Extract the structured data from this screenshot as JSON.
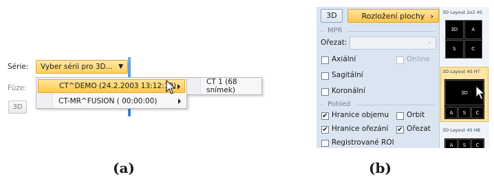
{
  "panel_a": {
    "series_label": "Série:",
    "series_value": "Vyber sérii pro 3D...",
    "fusion_label": "Fúze:",
    "btn_3d": "3D",
    "menu_items": [
      "CT^DEMO (24.2.2003 13:12:10)",
      "CT-MR^FUSION ( 00:00:00)"
    ],
    "submenu_item": "CT 1 (68 snímek)"
  },
  "panel_b": {
    "btn_3d": "3D",
    "layout_button": "Rozložení plochy",
    "mpr_section": "MPR",
    "crop_label": "Ořezat:",
    "axial": "Axiální",
    "online": "Online",
    "sagittal": "Sagitální",
    "coronal": "Koronální",
    "view_section": "Pohled",
    "volume_borders": "Hranice objemu",
    "orbit": "Orbit",
    "crop_borders": "Hranice ořezání",
    "crop": "Ořezat",
    "registered_roi": "Registrované ROI",
    "layouts": [
      {
        "title": "3D Layout 2x2 4S",
        "cells": [
          "3D",
          "A",
          "S",
          "C"
        ]
      },
      {
        "title": "3D Layout 4S HT",
        "cells": [
          "3D",
          "A",
          "S",
          "C"
        ]
      },
      {
        "title": "3D Layout 4S HB",
        "cells": [
          "A",
          "S",
          "C"
        ]
      }
    ]
  },
  "captions": {
    "a": "(a)",
    "b": "(b)"
  }
}
